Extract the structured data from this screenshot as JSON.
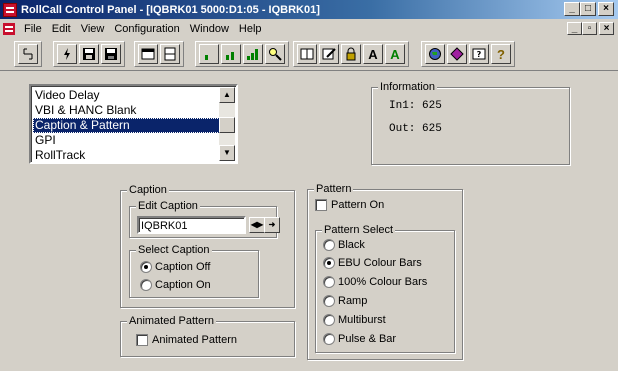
{
  "window": {
    "title": "RollCall Control Panel - [IQBRK01 5000:D1:05 - IQBRK01]",
    "controls": {
      "minimize": "_",
      "maximize": "□",
      "close": "×"
    }
  },
  "menu": {
    "items": [
      "File",
      "Edit",
      "View",
      "Configuration",
      "Window",
      "Help"
    ],
    "mdi_controls": {
      "minimize": "_",
      "restore": "▫",
      "close": "×"
    }
  },
  "toolbar": {
    "groups": [
      [
        "network-icon"
      ],
      [
        "lightning-icon",
        "save-edit-icon",
        "save-icon"
      ],
      [
        "window-icon",
        "window-split-icon"
      ],
      [
        "signal-low-icon",
        "signal-mid-icon",
        "signal-high-icon",
        "search-icon"
      ],
      [
        "book-icon",
        "edit-doc-icon",
        "lock-icon",
        "font-A-icon",
        "font-A-green-icon"
      ],
      [
        "globe-icon",
        "diamond-icon",
        "help-cursor-icon",
        "help-icon"
      ]
    ],
    "labels": {
      "font_a": "A",
      "font_a2": "A",
      "help": "?"
    }
  },
  "listbox": {
    "items": [
      "Video Delay",
      "VBI & HANC Blank",
      "Caption & Pattern",
      "GPI",
      "RollTrack"
    ],
    "selected": "Caption & Pattern"
  },
  "information": {
    "label": "Information",
    "in_line": "In1: 625",
    "out_line": "Out: 625"
  },
  "caption": {
    "label": "Caption",
    "edit_caption_label": "Edit Caption",
    "edit_caption_value": "IQBRK01",
    "select_caption_label": "Select Caption",
    "options": [
      "Caption Off",
      "Caption On"
    ],
    "selected": "Caption Off"
  },
  "animated_pattern": {
    "label": "Animated Pattern",
    "checkbox_label": "Animated Pattern",
    "checked": false
  },
  "pattern": {
    "label": "Pattern",
    "pattern_on_label": "Pattern On",
    "pattern_on_checked": false,
    "select_label": "Pattern Select",
    "options": [
      "Black",
      "EBU Colour Bars",
      "100% Colour Bars",
      "Ramp",
      "Multiburst",
      "Pulse & Bar"
    ],
    "selected": "EBU Colour Bars"
  },
  "colors": {
    "title_bar_start": "#0a246a",
    "selection": "#0a246a",
    "face": "#d4d0c8",
    "app_icon": "#c8102e"
  }
}
